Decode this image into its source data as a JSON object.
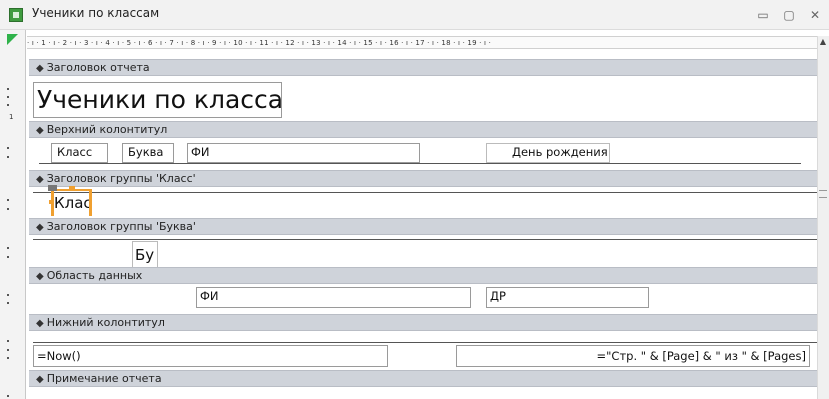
{
  "window": {
    "title": "Ученики по классам",
    "minimize_glyph": "▭",
    "maximize_glyph": "▢",
    "close_glyph": "✕"
  },
  "ruler": {
    "text": "· ı · 1 · ı · 2 · ı · 3 · ı · 4 · ı · 5 · ı · 6 · ı · 7 · ı · 8 · ı · 9 · ı · 10 · ı · 11 · ı · 12 · ı · 13 · ı · 14 · ı · 15 · ı · 16 · ı · 17 · ı · 18 · ı · 19 · ı ·"
  },
  "gutter": {
    "ruler_mark": "1"
  },
  "sections": {
    "report_header": "Заголовок отчета",
    "page_header": "Верхний колонтитул",
    "group_class_header": "Заголовок группы 'Класс'",
    "group_letter_header": "Заголовок группы 'Буква'",
    "detail": "Область данных",
    "page_footer": "Нижний колонтитул",
    "report_footer": "Примечание отчета"
  },
  "controls": {
    "report_title": "Ученики по классам",
    "label_class": "Класс",
    "label_letter": "Буква",
    "label_fio": "ФИ",
    "label_birthday": "День рождения",
    "field_class": "Клас",
    "field_letter": "Бу",
    "field_fio": "ФИ",
    "field_dr": "ДР",
    "field_now": "=Now()",
    "field_pages": "=\"Стр. \" & [Page] & \" из \" & [Pages]"
  },
  "colors": {
    "selection": "#f0a030",
    "icon_green": "#3f9b3f",
    "section_bar": "#cfd3da"
  }
}
